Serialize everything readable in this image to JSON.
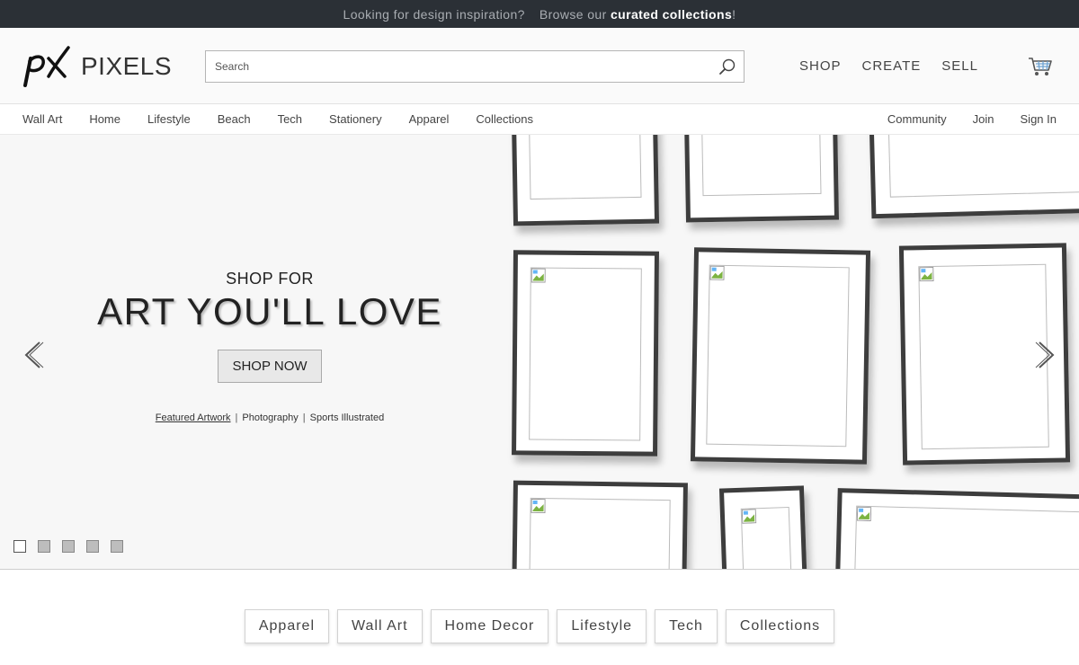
{
  "promo": {
    "text": "Looking for design inspiration?",
    "browse_prefix": "Browse our",
    "browse_link": "curated collections",
    "browse_suffix": "!"
  },
  "header": {
    "logo_text": "PIXELS",
    "search_placeholder": "Search",
    "nav": [
      "SHOP",
      "CREATE",
      "SELL"
    ]
  },
  "categories": {
    "left": [
      "Wall Art",
      "Home",
      "Lifestyle",
      "Beach",
      "Tech",
      "Stationery",
      "Apparel",
      "Collections"
    ],
    "right": [
      "Community",
      "Join",
      "Sign In"
    ]
  },
  "hero": {
    "kicker": "SHOP FOR",
    "title": "ART YOU'LL LOVE",
    "button": "SHOP NOW",
    "links": [
      "Featured Artwork",
      "Photography",
      "Sports Illustrated"
    ],
    "active_link": 0,
    "slide_count": 5,
    "active_slide": 0
  },
  "pills": [
    "Apparel",
    "Wall Art",
    "Home Decor",
    "Lifestyle",
    "Tech",
    "Collections"
  ],
  "colors": {
    "promo_bg": "#2b3036",
    "frame": "#3d3d3d",
    "hero_bg": "#f7f7f7"
  },
  "icons": {
    "search": "search-icon",
    "cart": "cart-icon",
    "prev": "chevron-left-icon",
    "next": "chevron-right-icon"
  }
}
